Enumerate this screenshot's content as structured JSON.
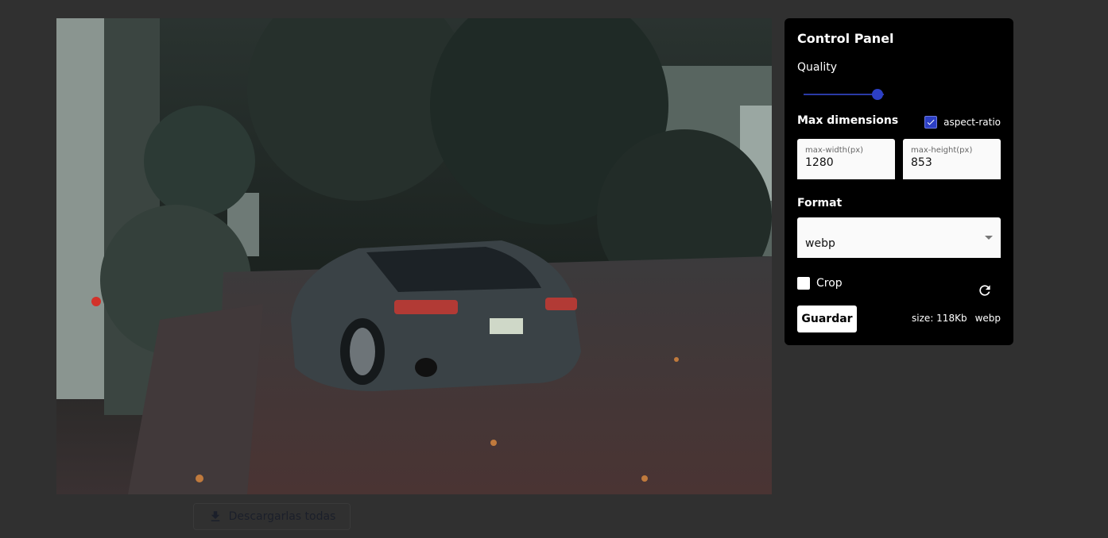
{
  "photo": {
    "subject": "dark car in driveway photo"
  },
  "download_all": {
    "label": "Descargarlas todas",
    "icon": "download-icon"
  },
  "control_panel": {
    "title": "Control Panel",
    "quality": {
      "label": "Quality",
      "value_fraction": 0.92,
      "accent": "#2c3fc4"
    },
    "max_dimensions": {
      "label": "Max dimensions",
      "aspect_ratio": {
        "label": "aspect-ratio",
        "checked": true
      },
      "width": {
        "label": "max-width(px)",
        "value": "1280"
      },
      "height": {
        "label": "max-height(px)",
        "value": "853"
      }
    },
    "format": {
      "label": "Format",
      "selected": "webp"
    },
    "crop": {
      "label": "Crop",
      "checked": false
    },
    "reset_icon": "refresh-icon",
    "save_label": "Guardar",
    "size_text": "size: 118Kb",
    "format_text": "webp"
  }
}
